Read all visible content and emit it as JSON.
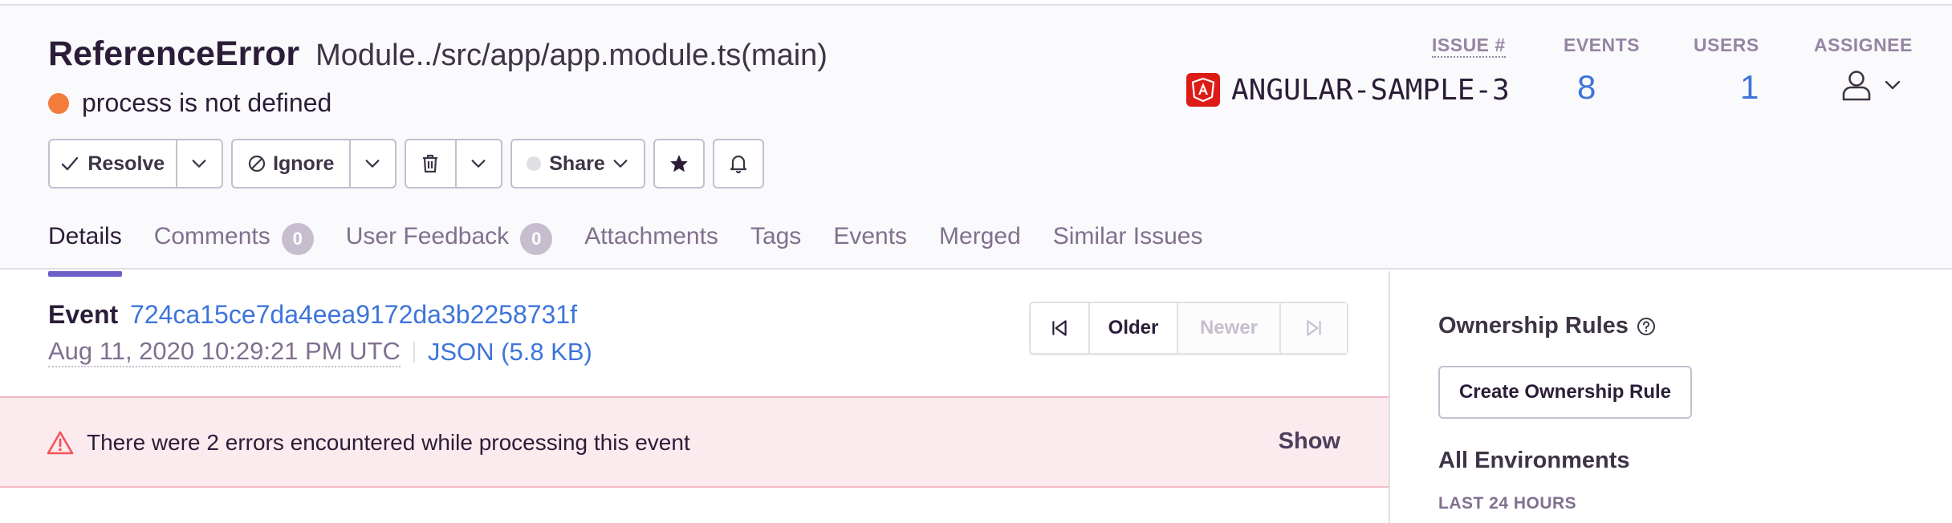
{
  "issue": {
    "type": "ReferenceError",
    "culprit": "Module../src/app/app.module.ts(main)",
    "message": "process is not defined",
    "level_color": "#f37c3c"
  },
  "actions": {
    "resolve": "Resolve",
    "ignore": "Ignore",
    "share": "Share"
  },
  "stats": {
    "issue_label": "ISSUE #",
    "project_name": "ANGULAR-SAMPLE-3",
    "events_label": "EVENTS",
    "events_value": "8",
    "users_label": "USERS",
    "users_value": "1",
    "assignee_label": "ASSIGNEE"
  },
  "tabs": [
    {
      "label": "Details",
      "active": true
    },
    {
      "label": "Comments",
      "count": "0"
    },
    {
      "label": "User Feedback",
      "count": "0"
    },
    {
      "label": "Attachments"
    },
    {
      "label": "Tags"
    },
    {
      "label": "Events"
    },
    {
      "label": "Merged"
    },
    {
      "label": "Similar Issues"
    }
  ],
  "event": {
    "label": "Event",
    "id": "724ca15ce7da4eea9172da3b2258731f",
    "date": "Aug 11, 2020 10:29:21 PM UTC",
    "json_link": "JSON (5.8 KB)",
    "older": "Older",
    "newer": "Newer"
  },
  "error_banner": {
    "text": "There were 2 errors encountered while processing this event",
    "show": "Show"
  },
  "sidebar": {
    "ownership_title": "Ownership Rules",
    "create_rule": "Create Ownership Rule",
    "environments_title": "All Environments",
    "range_label": "LAST 24 HOURS"
  },
  "colors": {
    "accent": "#6c5fc7",
    "link": "#3d74db",
    "error_bg": "#fcebee",
    "angular_red": "#dd1b16"
  },
  "icons": [
    "check-icon",
    "chevron-down-icon",
    "ignore-icon",
    "trash-icon",
    "star-icon",
    "bell-icon",
    "angular-icon",
    "user-icon",
    "first-page-icon",
    "last-page-icon",
    "warning-icon",
    "help-icon"
  ]
}
